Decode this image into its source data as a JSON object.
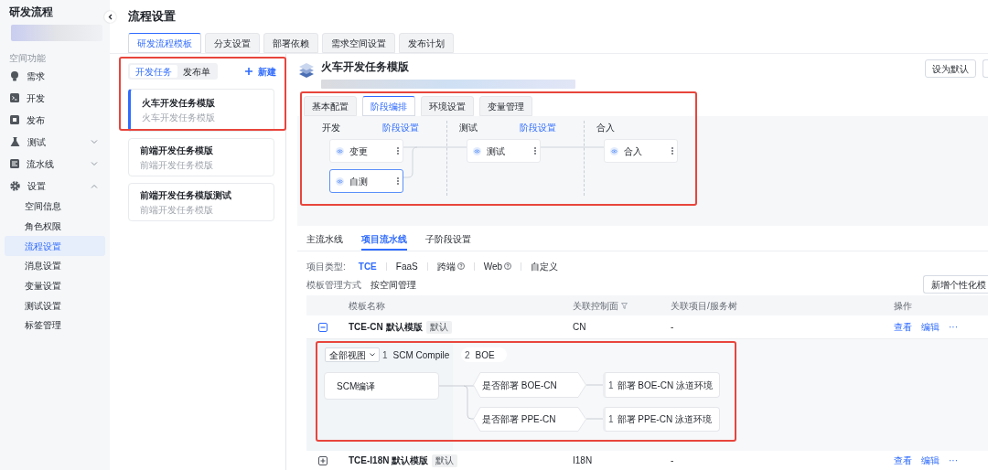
{
  "sidebar": {
    "title": "研发流程",
    "section_label": "空间功能",
    "items": [
      {
        "label": "需求",
        "kind": "link",
        "selected": false
      },
      {
        "label": "开发",
        "kind": "link",
        "selected": false
      },
      {
        "label": "发布",
        "kind": "link",
        "selected": false
      },
      {
        "label": "测试",
        "kind": "group",
        "selected": false,
        "expanded": false
      },
      {
        "label": "流水线",
        "kind": "group",
        "selected": false,
        "expanded": false
      },
      {
        "label": "设置",
        "kind": "group",
        "selected": false,
        "expanded": true,
        "children": [
          {
            "label": "空间信息",
            "selected": false
          },
          {
            "label": "角色权限",
            "selected": false
          },
          {
            "label": "流程设置",
            "selected": true
          },
          {
            "label": "消息设置",
            "selected": false
          },
          {
            "label": "变量设置",
            "selected": false
          },
          {
            "label": "测试设置",
            "selected": false
          },
          {
            "label": "标签管理",
            "selected": false
          }
        ]
      }
    ]
  },
  "page": {
    "title": "流程设置",
    "tabs": [
      {
        "label": "研发流程模板",
        "selected": true
      },
      {
        "label": "分支设置",
        "selected": false
      },
      {
        "label": "部署依赖",
        "selected": false
      },
      {
        "label": "需求空间设置",
        "selected": false
      },
      {
        "label": "发布计划",
        "selected": false
      }
    ]
  },
  "template_list": {
    "segments": [
      {
        "label": "开发任务",
        "selected": true
      },
      {
        "label": "发布单",
        "selected": false
      }
    ],
    "new_button": "新建",
    "templates": [
      {
        "title": "火车开发任务模版",
        "subtitle": "火车开发任务模版",
        "selected": true
      },
      {
        "title": "前端开发任务模版",
        "subtitle": "前端开发任务模版",
        "selected": false
      },
      {
        "title": "前端开发任务模版测试",
        "subtitle": "前端开发任务模版",
        "selected": false
      }
    ]
  },
  "detail": {
    "title": "火车开发任务模版",
    "buttons": [
      "设为默认"
    ],
    "tabs": [
      {
        "label": "基本配置",
        "selected": false
      },
      {
        "label": "阶段编排",
        "selected": true
      },
      {
        "label": "环境设置",
        "selected": false
      },
      {
        "label": "变量管理",
        "selected": false
      }
    ],
    "stages": [
      {
        "name": "开发",
        "settings_link": "阶段设置",
        "tasks": [
          {
            "label": "变更",
            "selected": false
          },
          {
            "label": "自测",
            "selected": true
          }
        ]
      },
      {
        "name": "测试",
        "settings_link": "阶段设置",
        "tasks": [
          {
            "label": "测试",
            "selected": false
          }
        ]
      },
      {
        "name": "合入",
        "tasks": [
          {
            "label": "合入",
            "selected": false
          }
        ]
      }
    ]
  },
  "pipeline": {
    "tabs": [
      {
        "label": "主流水线",
        "selected": false
      },
      {
        "label": "项目流水线",
        "selected": true
      },
      {
        "label": "子阶段设置",
        "selected": false
      }
    ],
    "project_type_label": "项目类型:",
    "project_types": [
      {
        "label": "TCE",
        "selected": true,
        "help": false
      },
      {
        "label": "FaaS",
        "selected": false,
        "help": false
      },
      {
        "label": "跨端",
        "selected": false,
        "help": true
      },
      {
        "label": "Web",
        "selected": false,
        "help": true
      },
      {
        "label": "自定义",
        "selected": false,
        "help": false
      }
    ],
    "management_label": "模板管理方式",
    "management_value": "按空间管理",
    "add_button": "新增个性化模",
    "table": {
      "columns": [
        "模板名称",
        "关联控制面",
        "关联项目/服务树",
        "操作"
      ],
      "rows": [
        {
          "name": "TCE-CN 默认模版",
          "badge": "默认",
          "control_plane": "CN",
          "project": "-",
          "actions": [
            "查看",
            "编辑",
            "···"
          ],
          "expanded": true
        },
        {
          "name": "TCE-I18N 默认模版",
          "badge": "默认",
          "control_plane": "I18N",
          "project": "-",
          "actions": [
            "查看",
            "编辑",
            "···"
          ],
          "expanded": false
        }
      ]
    },
    "flow": {
      "view_select": "全部视图",
      "steps": [
        {
          "number": "1",
          "label": "SCM Compile"
        },
        {
          "number": "2",
          "label": "BOE"
        }
      ],
      "nodes": [
        {
          "kind": "task",
          "label": "SCM编译"
        },
        {
          "kind": "condition",
          "label": "是否部署 BOE-CN"
        },
        {
          "kind": "condition",
          "label": "是否部署 PPE-CN"
        },
        {
          "kind": "deploy",
          "number": "1",
          "label": "部署 BOE-CN 泳道环境"
        },
        {
          "kind": "deploy",
          "number": "1",
          "label": "部署 PPE-CN 泳道环境"
        }
      ]
    }
  }
}
